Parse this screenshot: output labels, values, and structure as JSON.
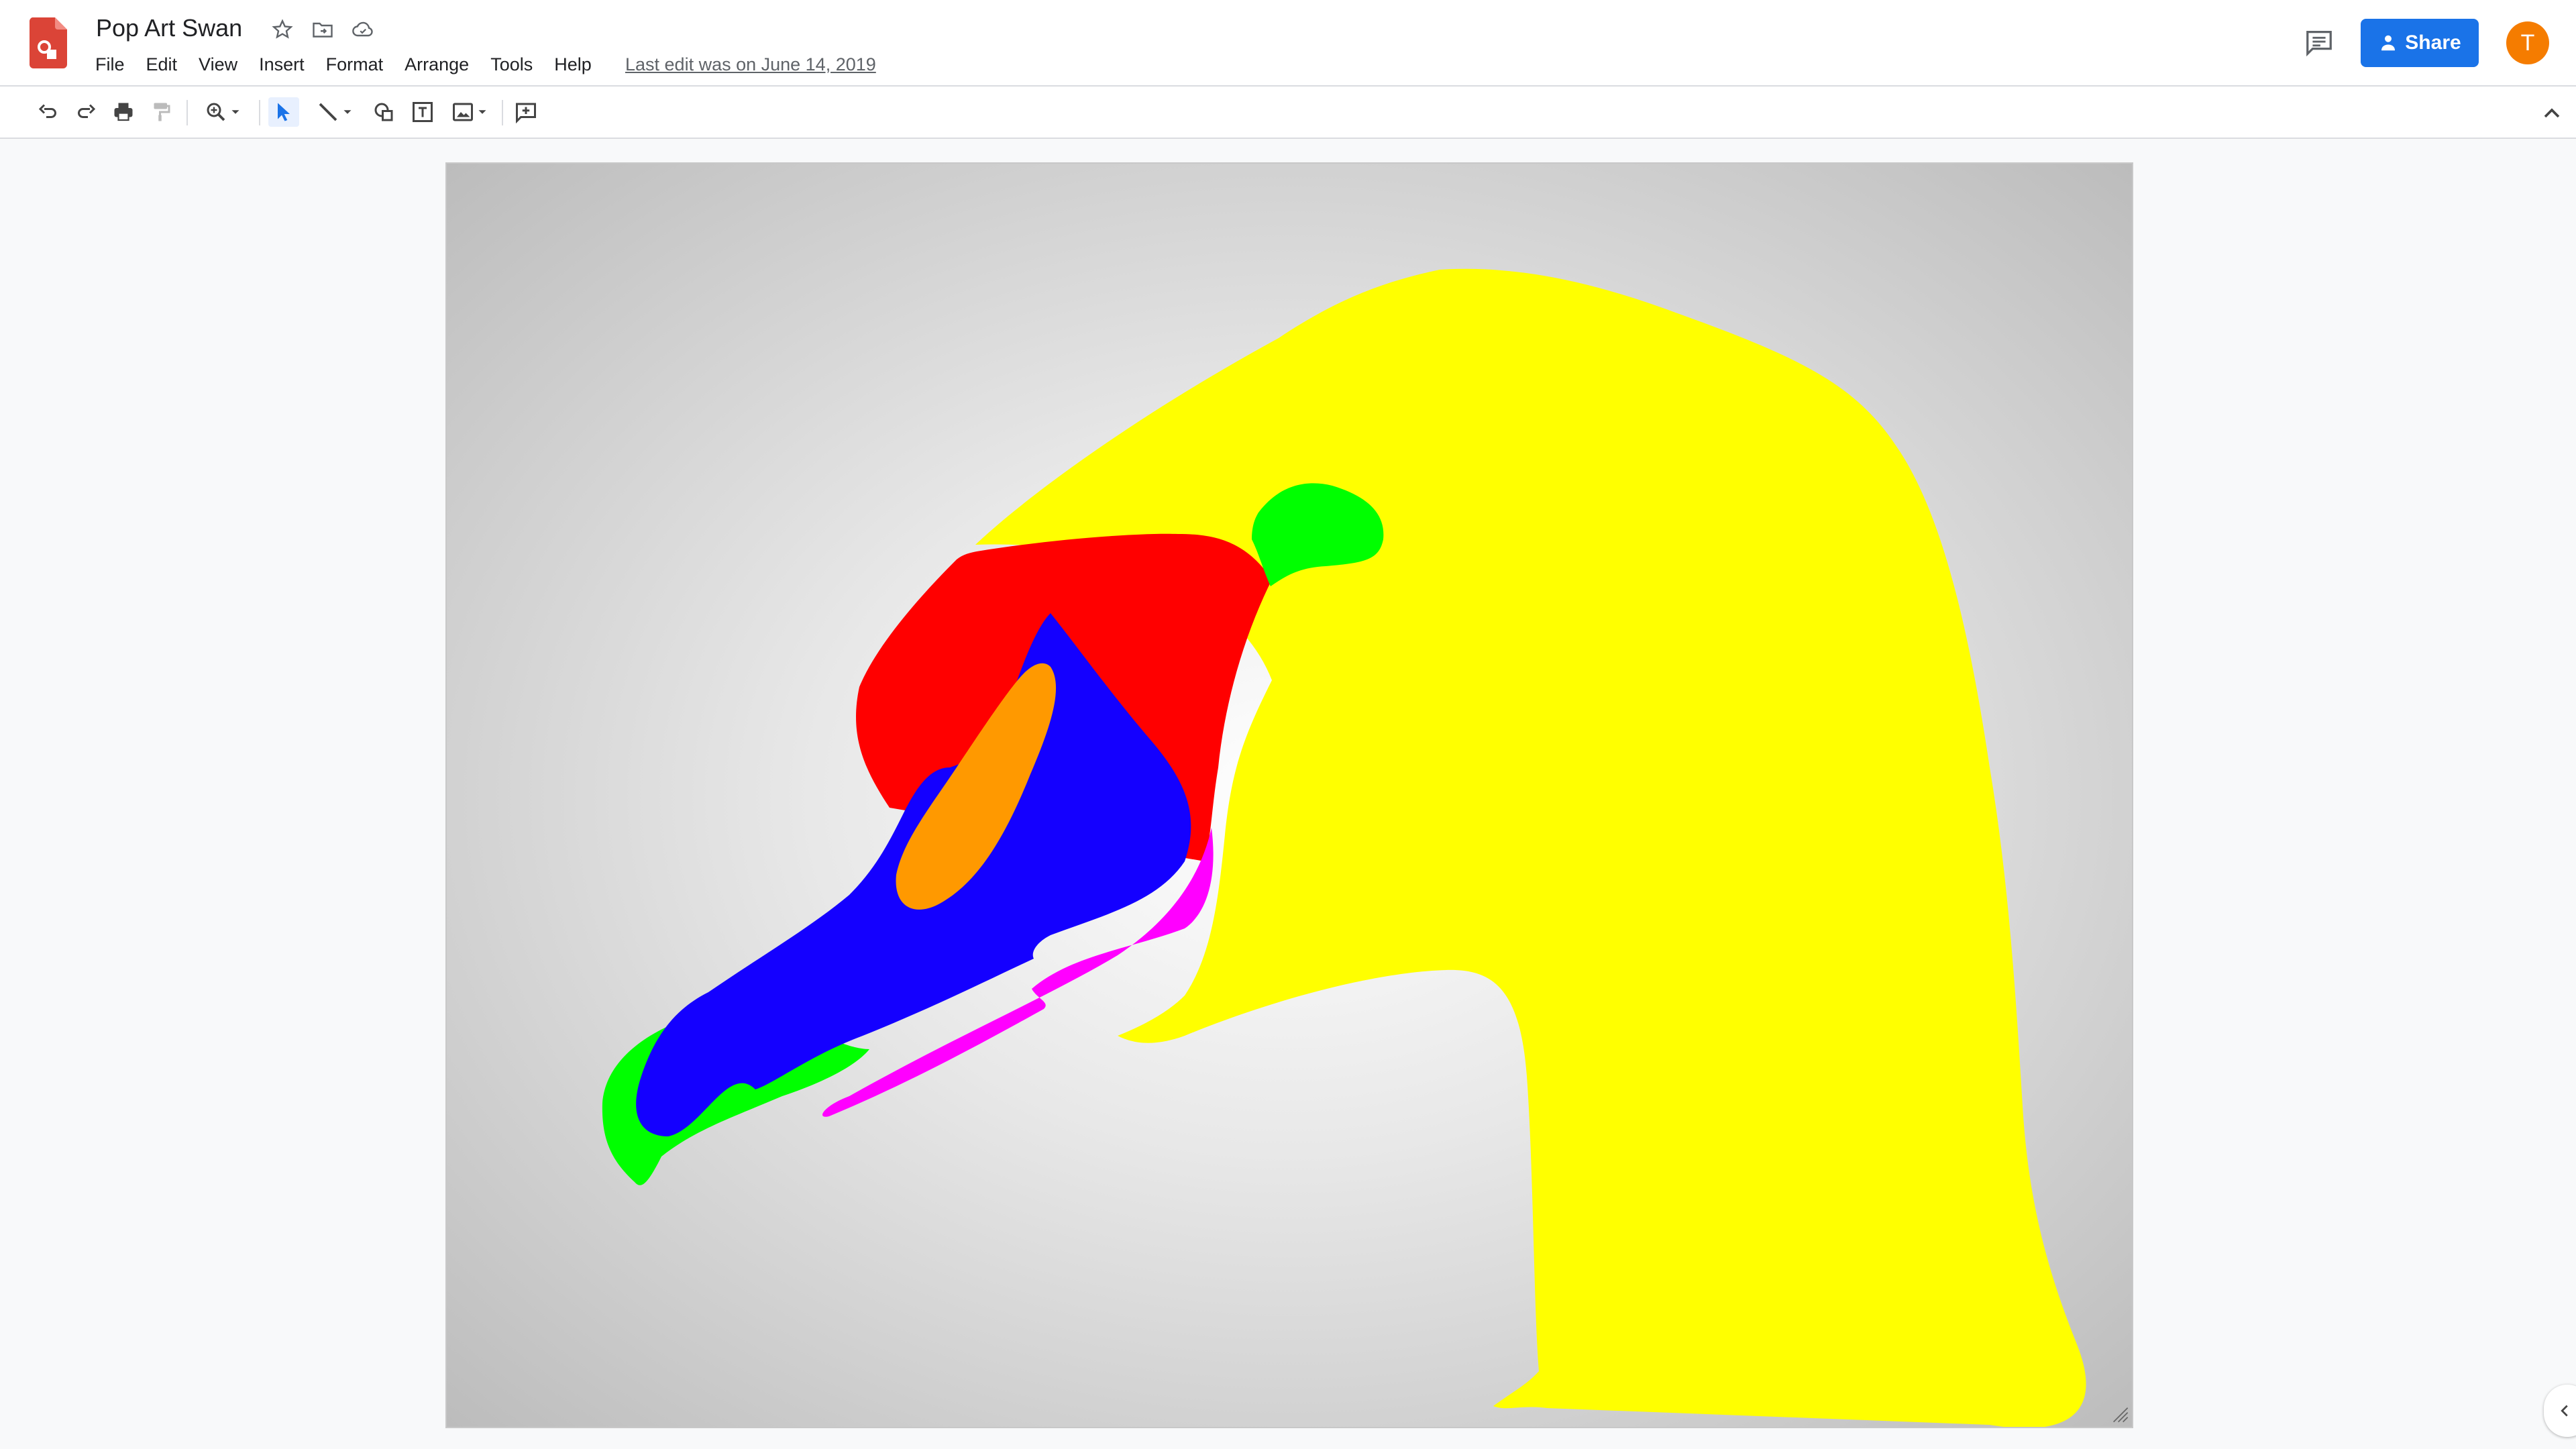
{
  "app": {
    "name": "Google Drawings",
    "doc_title": "Pop Art Swan",
    "last_edit": "Last edit was on June 14, 2019"
  },
  "menu": [
    "File",
    "Edit",
    "View",
    "Insert",
    "Format",
    "Arrange",
    "Tools",
    "Help"
  ],
  "header": {
    "share_label": "Share",
    "avatar_initial": "T"
  },
  "toolbar": {
    "icons": [
      "undo-icon",
      "redo-icon",
      "print-icon",
      "paint-format-icon",
      "zoom-icon",
      "select-icon",
      "line-icon",
      "shape-icon",
      "textbox-icon",
      "image-icon",
      "add-comment-icon"
    ]
  },
  "colors": {
    "accent": "#1a73e8",
    "avatar": "#f57c00",
    "swan_yellow": "#ffff00",
    "swan_red": "#ff0000",
    "swan_blue": "#1400ff",
    "swan_orange": "#ff9900",
    "swan_green": "#00ff00",
    "swan_magenta": "#ff00ff"
  }
}
